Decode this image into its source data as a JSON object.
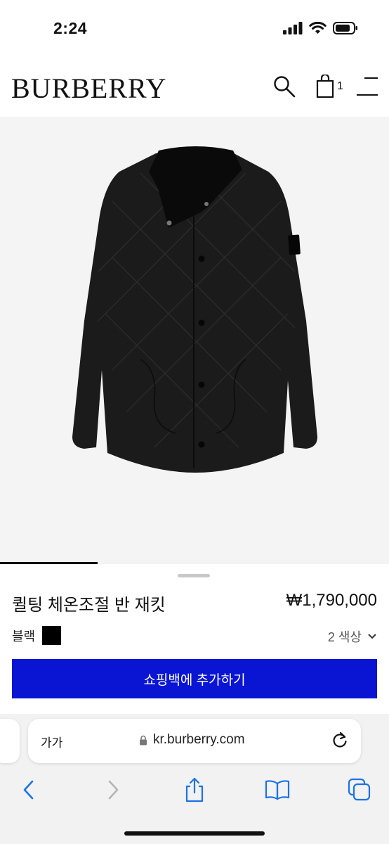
{
  "status_bar": {
    "time": "2:24"
  },
  "header": {
    "brand": "BURBERRY",
    "bag_count": "1"
  },
  "product": {
    "name": "퀼팅 체온조절 반 재킷",
    "price": "₩1,790,000",
    "color_label": "블랙",
    "color_swatch": "#000000",
    "color_count": "2 색상",
    "add_to_bag_label": "쇼핑백에 추가하기"
  },
  "browser": {
    "text_size_label": "가가",
    "url": "kr.burberry.com"
  },
  "colors": {
    "accent": "#0a15d4",
    "image_background": "#f4f4f4",
    "browser_chrome": "#f2f2f2",
    "link_blue": "#1a73e8"
  }
}
